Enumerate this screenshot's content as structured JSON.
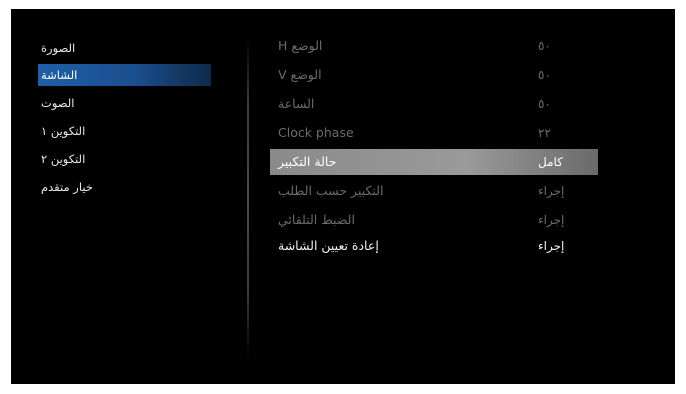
{
  "sidebar": {
    "items": [
      {
        "label": "الصورة"
      },
      {
        "label": "الشاشة"
      },
      {
        "label": "الصوت"
      },
      {
        "label": "التكوين ١"
      },
      {
        "label": "التكوين ٢"
      },
      {
        "label": "خيار متقدم"
      }
    ],
    "selected": "الشاشة"
  },
  "settings": {
    "rows": [
      {
        "label": "الوضع H",
        "value": "٥٠",
        "state": "disabled"
      },
      {
        "label": "الوضع  V",
        "value": "٥٠",
        "state": "disabled"
      },
      {
        "label": "الساعة",
        "value": "٥٠",
        "state": "disabled"
      },
      {
        "label": "Clock phase",
        "value": "٢٢",
        "state": "disabled"
      },
      {
        "label": "حالة التكبير",
        "value": "كامل",
        "state": "selected"
      },
      {
        "label": "التكبير حسب الطلب",
        "value": "إجراء",
        "state": "disabled"
      },
      {
        "label": "الضبط التلقائي",
        "value": "إجراء",
        "state": "disabled"
      },
      {
        "label": "إعادة تعيين الشاشة",
        "value": "إجراء",
        "state": "enabled"
      }
    ]
  },
  "colors": {
    "background": "#000000",
    "sidebar_selected": "#1e5fa8",
    "row_selected": "#8a8a8a",
    "text_enabled": "#f0f0f0",
    "text_disabled": "#6b6b6b"
  }
}
